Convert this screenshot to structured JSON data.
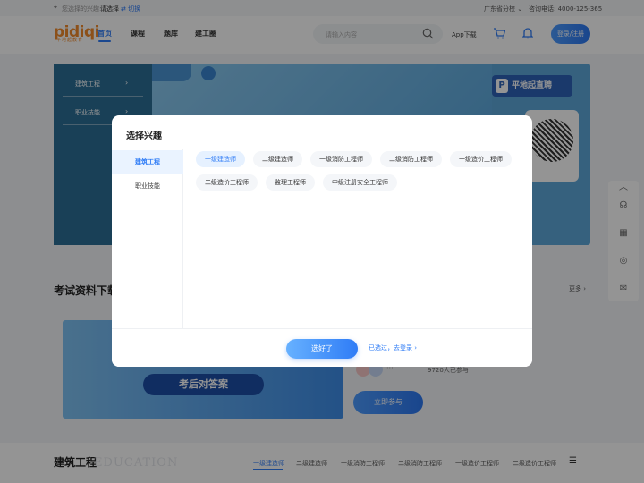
{
  "topbar": {
    "interest_prefix": "您选择的兴趣:",
    "interest_value": "请选择",
    "switch_label": "切换",
    "region": "广东省分校",
    "hotline": "咨询电话: 4000-125-365"
  },
  "header": {
    "logo": "pidiqi",
    "logo_sub": "平地起教育",
    "nav": [
      "首页",
      "课程",
      "题库",
      "建工圈"
    ],
    "search_placeholder": "请输入内容",
    "app_download": "App下载",
    "login": "登录/注册"
  },
  "banner": {
    "side_items": [
      "建筑工程",
      "职业技能"
    ],
    "brand": "平地起直聘"
  },
  "section": {
    "title": "考试资料下载",
    "more": "更多",
    "card_pill": "考后对答案",
    "participants": "9720人已参与",
    "join": "立即参与"
  },
  "bottom": {
    "title": "建筑工程",
    "watermark": "EDUCATION",
    "tabs": [
      "一级建造师",
      "二级建造师",
      "一级消防工程师",
      "二级消防工程师",
      "一级造价工程师",
      "二级造价工程师"
    ]
  },
  "modal": {
    "title": "选择兴趣",
    "categories": [
      "建筑工程",
      "职业技能"
    ],
    "tags_row1": [
      "一级建造师",
      "二级建造师",
      "一级消防工程师",
      "二级消防工程师",
      "一级造价工程师"
    ],
    "tags_row2": [
      "二级造价工程师",
      "监理工程师",
      "中级注册安全工程师"
    ],
    "ok": "选好了",
    "skip": "已选过，去登录"
  },
  "colors": {
    "accent": "#2f7cf6",
    "brand": "#f28a2b"
  }
}
